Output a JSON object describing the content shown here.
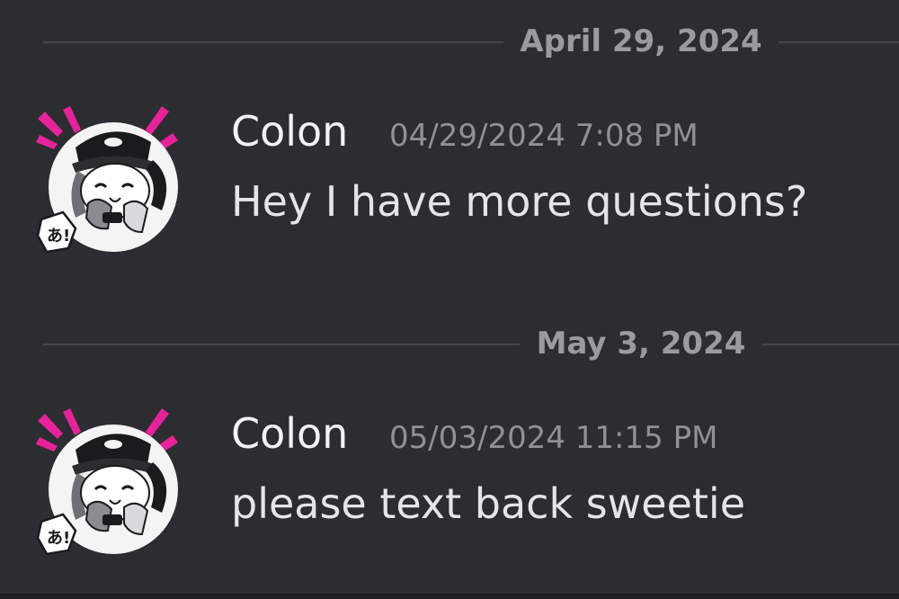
{
  "messages_view": {
    "groups": [
      {
        "date_divider": "April 29, 2024",
        "author": "Colon",
        "timestamp": "04/29/2024 7:08 PM",
        "content": "Hey I have more questions?"
      },
      {
        "date_divider": "May 3, 2024",
        "author": "Colon",
        "timestamp": "05/03/2024 11:15 PM",
        "content": "please text back sweetie"
      }
    ]
  },
  "icons": {
    "avatar": "anime-character-avatar-icon"
  },
  "colors": {
    "background": "#2c2d31",
    "divider_line": "#46474d",
    "date_text": "#999ba1",
    "author_text": "#f1f2f5",
    "timestamp_text": "#8f9197",
    "message_text": "#e4e5e8",
    "avatar_accent": "#e8229a"
  }
}
